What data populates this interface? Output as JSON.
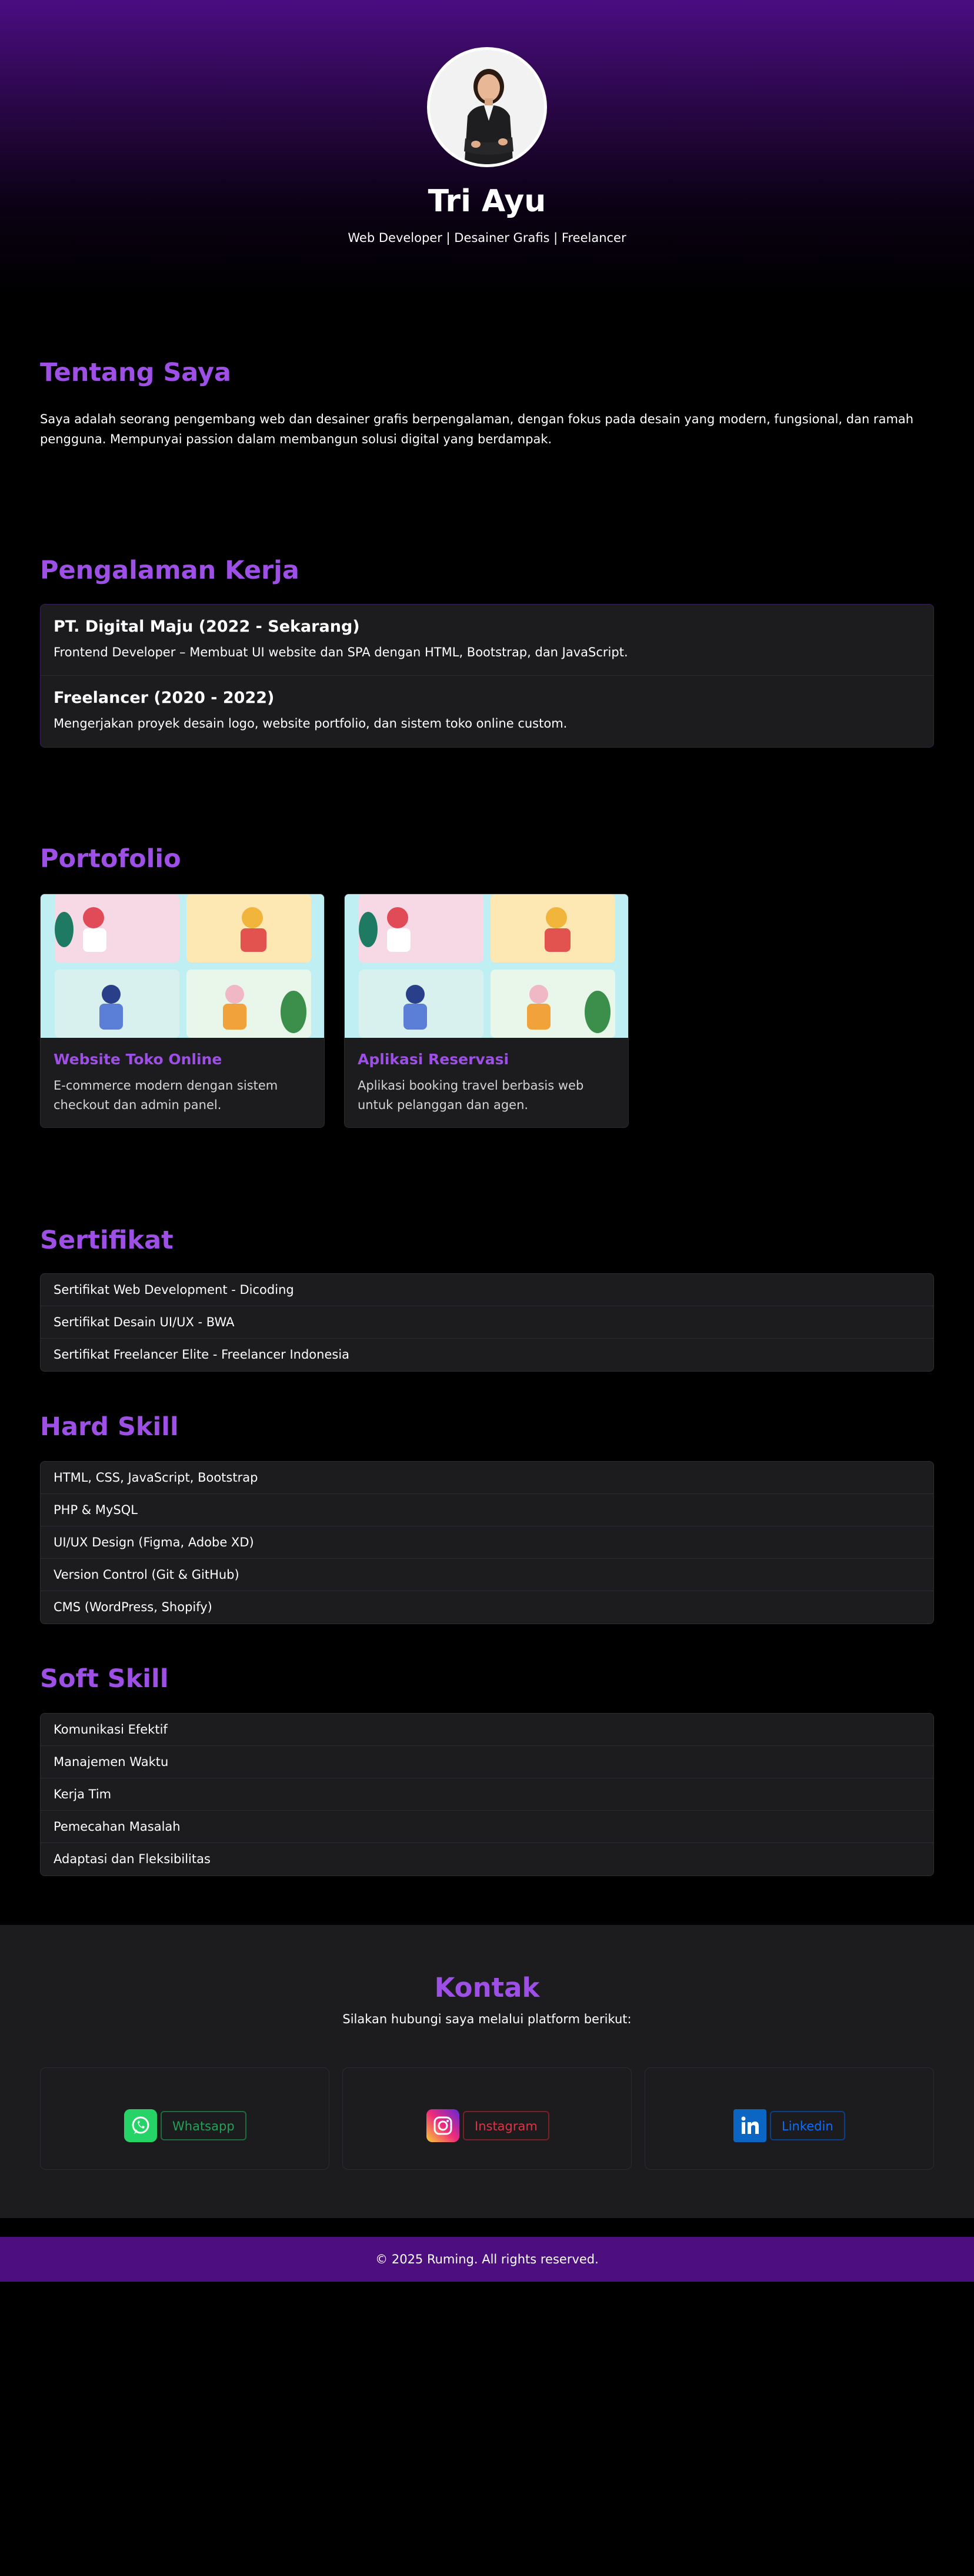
{
  "hero": {
    "name": "Tri Ayu",
    "tagline": "Web Developer | Desainer Grafis | Freelancer"
  },
  "about": {
    "title": "Tentang Saya",
    "text": "Saya adalah seorang pengembang web dan desainer grafis berpengalaman, dengan fokus pada desain yang modern, fungsional, dan ramah pengguna. Mempunyai passion dalam membangun solusi digital yang berdampak."
  },
  "experience": {
    "title": "Pengalaman Kerja",
    "items": [
      {
        "head": "PT. Digital Maju (2022 - Sekarang)",
        "desc": "Frontend Developer – Membuat UI website dan SPA dengan HTML, Bootstrap, dan JavaScript."
      },
      {
        "head": "Freelancer (2020 - 2022)",
        "desc": "Mengerjakan proyek desain logo, website portfolio, dan sistem toko online custom."
      }
    ]
  },
  "portfolio": {
    "title": "Portofolio",
    "cards": [
      {
        "title": "Website Toko Online",
        "desc": "E-commerce modern dengan sistem checkout dan admin panel."
      },
      {
        "title": "Aplikasi Reservasi",
        "desc": "Aplikasi booking travel berbasis web untuk pelanggan dan agen."
      }
    ]
  },
  "certificates": {
    "title": "Sertifikat",
    "items": [
      "Sertifikat Web Development - Dicoding",
      "Sertifikat Desain UI/UX - BWA",
      "Sertifikat Freelancer Elite - Freelancer Indonesia"
    ]
  },
  "hard_skill": {
    "title": "Hard Skill",
    "items": [
      "HTML, CSS, JavaScript, Bootstrap",
      "PHP & MySQL",
      "UI/UX Design (Figma, Adobe XD)",
      "Version Control (Git & GitHub)",
      "CMS (WordPress, Shopify)"
    ]
  },
  "soft_skill": {
    "title": "Soft Skill",
    "items": [
      "Komunikasi Efektif",
      "Manajemen Waktu",
      "Kerja Tim",
      "Pemecahan Masalah",
      "Adaptasi dan Fleksibilitas"
    ]
  },
  "contact": {
    "title": "Kontak",
    "subtitle": "Silakan hubungi saya melalui platform berikut:",
    "links": [
      {
        "label": "Whatsapp",
        "icon": "whatsapp-icon",
        "color": "#25d366"
      },
      {
        "label": "Instagram",
        "icon": "instagram-icon",
        "color": "#dc3545"
      },
      {
        "label": "Linkedin",
        "icon": "linkedin-icon",
        "color": "#0d6efd"
      }
    ]
  },
  "footer": {
    "text": "© 2025 Ruming. All rights reserved."
  }
}
